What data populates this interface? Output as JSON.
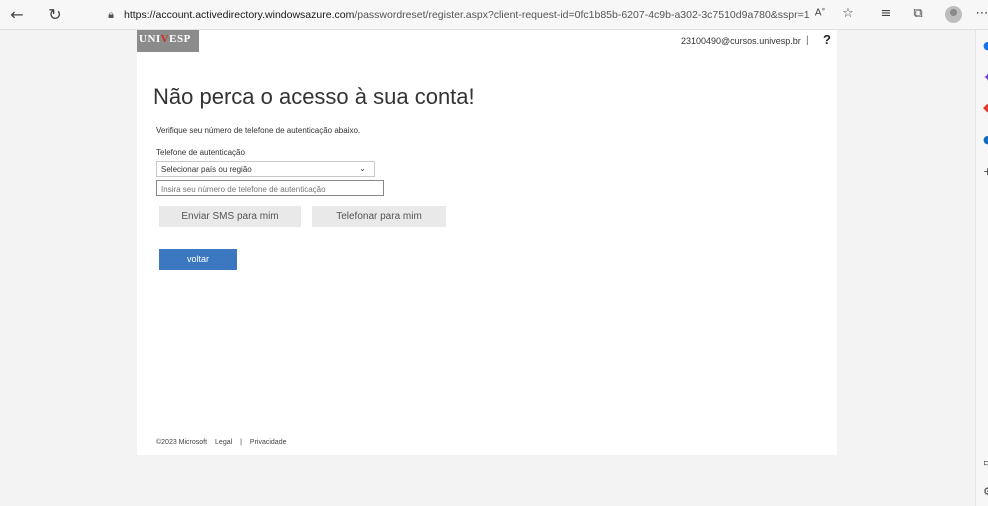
{
  "browser": {
    "url_host": "https://account.activedirectory.windowsazure.com",
    "url_path": "/passwordreset/register.aspx?client-request-id=0fc1b85b-6207-4c9b-a302-3c7510d9a780&sspr=1",
    "icons": [
      "back-icon",
      "refresh-icon",
      "lock-icon",
      "read-aloud-icon",
      "add-favorite-icon",
      "favorites-icon",
      "collections-icon",
      "profile-icon",
      "more-icon"
    ]
  },
  "sidebar": {
    "icons": [
      "search-icon",
      "copilot-icon",
      "office-icon",
      "outlook-icon",
      "add-icon",
      "split-screen-icon",
      "settings-icon"
    ]
  },
  "header": {
    "logo_text_a": "UNI",
    "logo_text_v": "V",
    "logo_text_b": "ESP",
    "user_email": "23100490@cursos.univesp.br",
    "separator": "|",
    "help": "?"
  },
  "main": {
    "title": "Não perca o acesso à sua conta!",
    "description": "Verifique seu número de telefone de autenticação abaixo.",
    "phone_label": "Telefone de autenticação",
    "country_select": "Selecionar país ou região",
    "phone_placeholder": "Insira seu número de telefone de autenticação",
    "sms_button": "Enviar SMS para mim",
    "call_button": "Telefonar para mim",
    "back_button": "voltar"
  },
  "footer": {
    "copyright": "©2023 Microsoft",
    "legal": "Legal",
    "separator": "|",
    "privacy": "Privacidade"
  },
  "colors": {
    "primary_button": "#3c77c1",
    "logo_bg": "#8b8b8b",
    "logo_accent": "#d52b1e"
  }
}
